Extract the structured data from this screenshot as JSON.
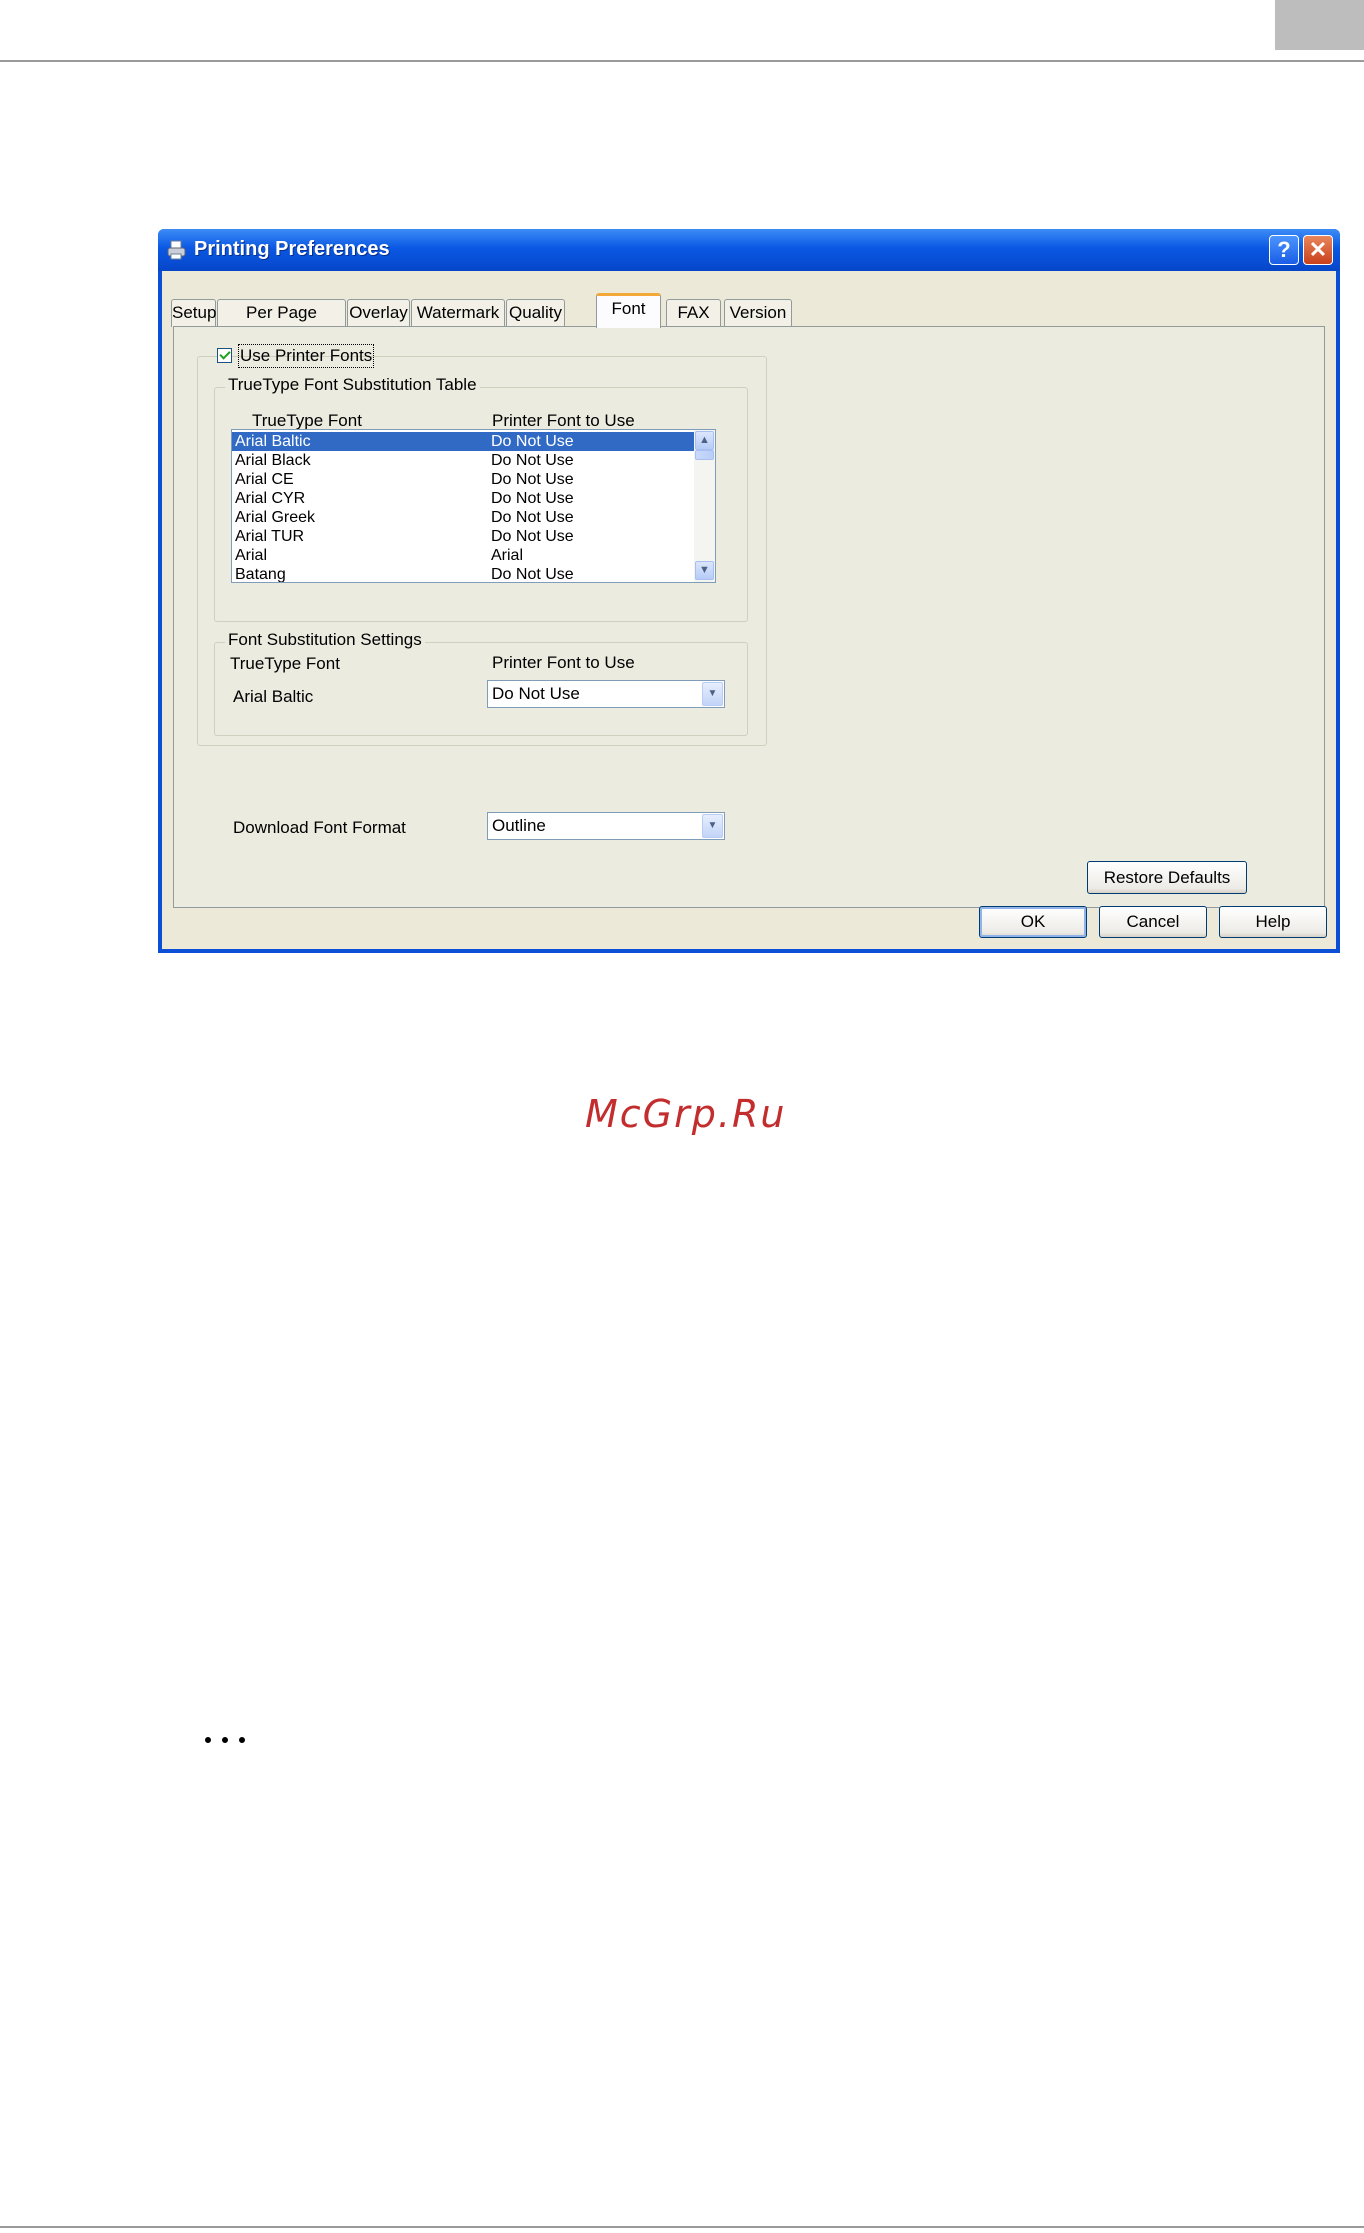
{
  "window": {
    "title": "Printing Preferences",
    "help_label": "?",
    "close_label": "✕"
  },
  "tabs": [
    {
      "label": "Setup",
      "active": false
    },
    {
      "label": "Per Page Setting",
      "active": false
    },
    {
      "label": "Overlay",
      "active": false
    },
    {
      "label": "Watermark",
      "active": false
    },
    {
      "label": "Quality",
      "active": false
    },
    {
      "label": "Font",
      "active": true
    },
    {
      "label": "FAX",
      "active": false
    },
    {
      "label": "Version",
      "active": false
    }
  ],
  "font_tab": {
    "use_printer_fonts": {
      "label": "Use Printer Fonts",
      "checked": true
    },
    "substitution_table": {
      "legend": "TrueType Font Substitution Table",
      "col1": "TrueType Font",
      "col2": "Printer Font to Use",
      "rows": [
        {
          "truetype": "Arial Baltic",
          "printer": "Do Not Use",
          "selected": true
        },
        {
          "truetype": "Arial Black",
          "printer": "Do Not Use",
          "selected": false
        },
        {
          "truetype": "Arial CE",
          "printer": "Do Not Use",
          "selected": false
        },
        {
          "truetype": "Arial CYR",
          "printer": "Do Not Use",
          "selected": false
        },
        {
          "truetype": "Arial Greek",
          "printer": "Do Not Use",
          "selected": false
        },
        {
          "truetype": "Arial TUR",
          "printer": "Do Not Use",
          "selected": false
        },
        {
          "truetype": "Arial",
          "printer": "Arial",
          "selected": false
        },
        {
          "truetype": "Batang",
          "printer": "Do Not Use",
          "selected": false
        }
      ]
    },
    "substitution_settings": {
      "legend": "Font Substitution Settings",
      "col1": "TrueType Font",
      "col2": "Printer Font to Use",
      "current_font": "Arial Baltic",
      "printer_font_value": "Do Not Use"
    },
    "download_font_format": {
      "label": "Download Font Format",
      "value": "Outline"
    },
    "restore_defaults_label": "Restore Defaults"
  },
  "buttons": {
    "ok": "OK",
    "cancel": "Cancel",
    "help": "Help"
  },
  "watermark_text": "McGrp.Ru"
}
